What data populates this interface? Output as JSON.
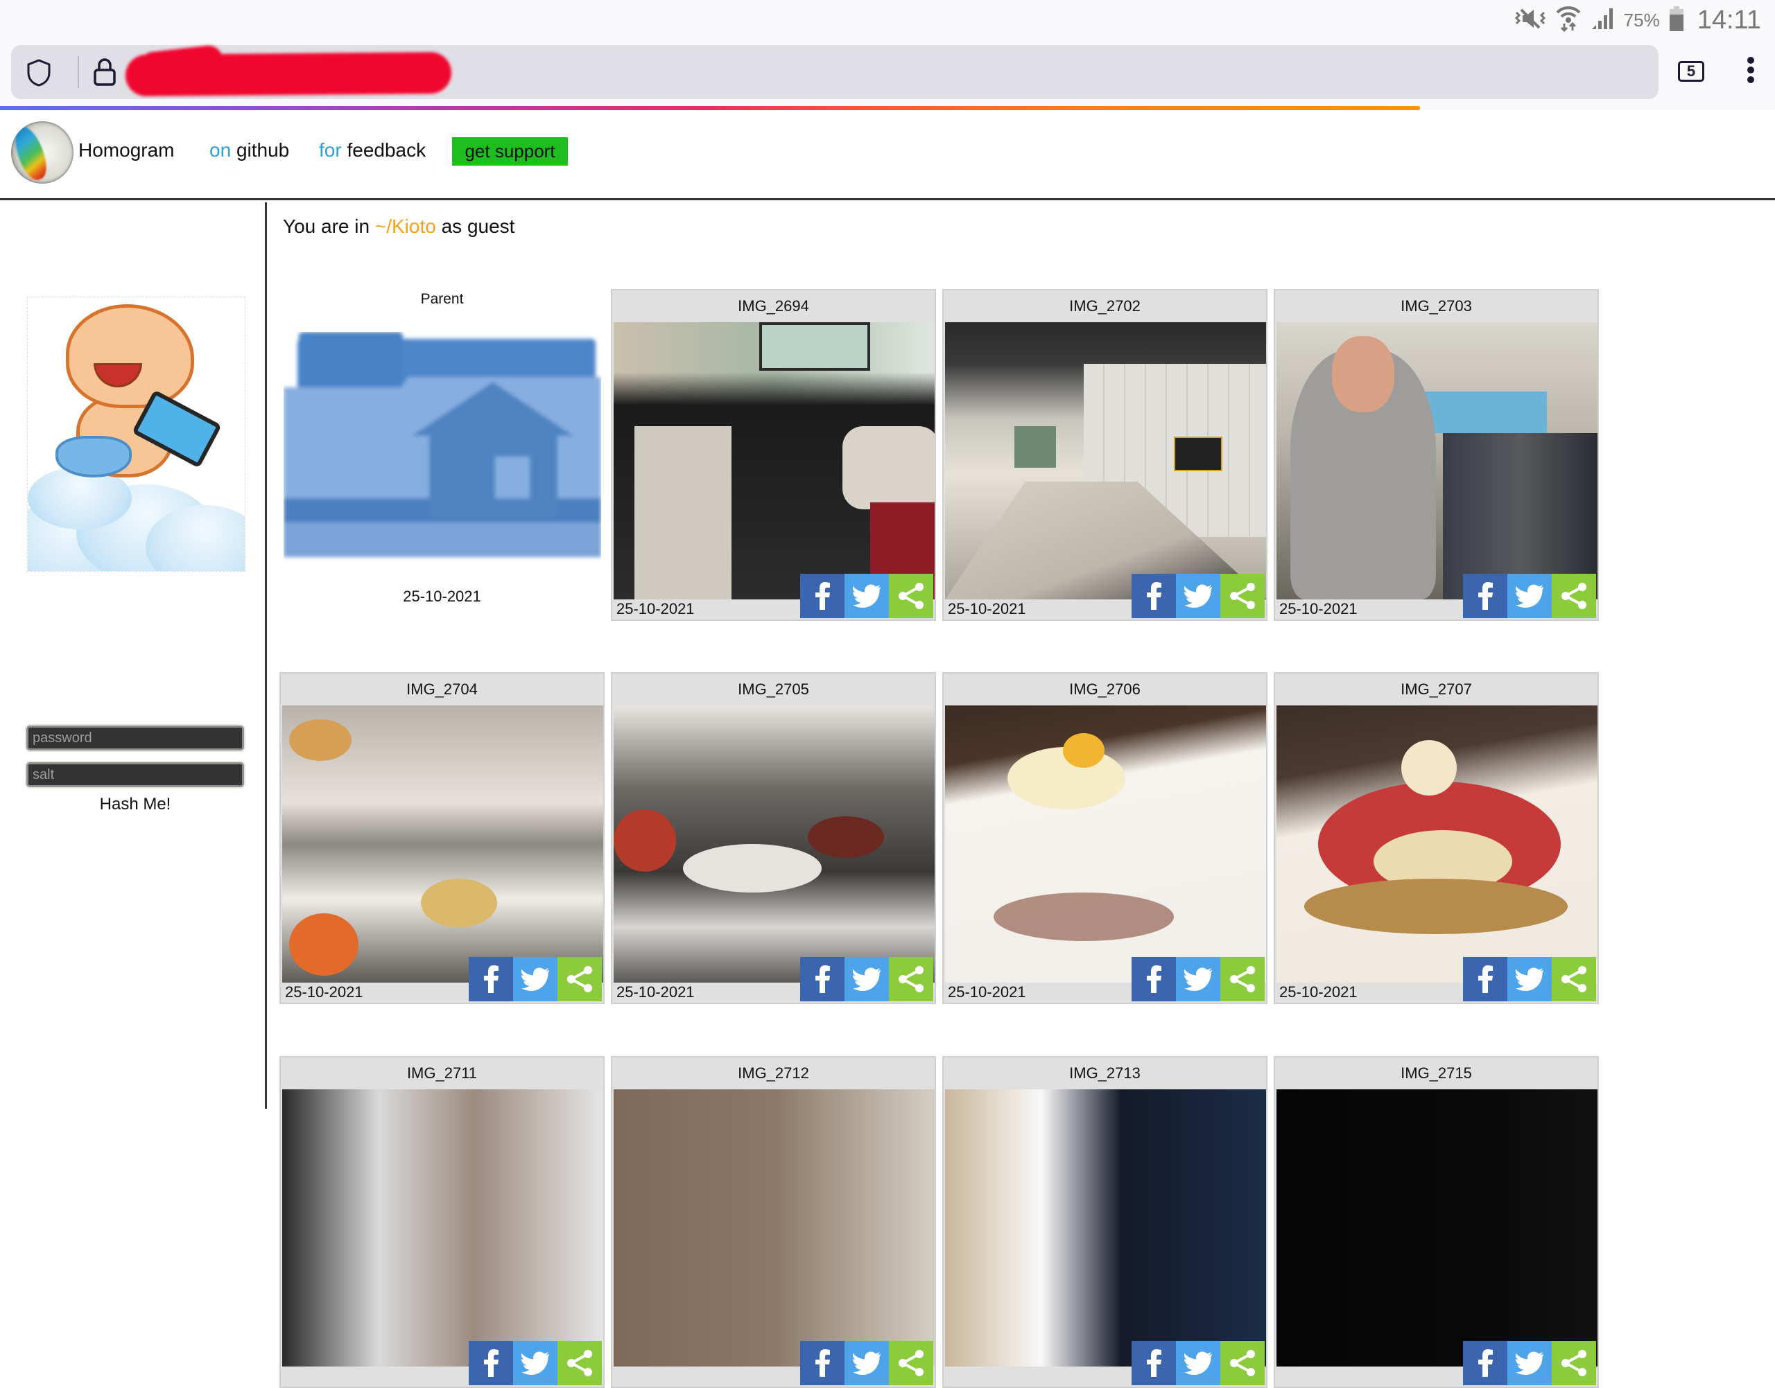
{
  "status_bar": {
    "icons": [
      "vibrate-off-icon",
      "wifi-data-icon",
      "signal-icon"
    ],
    "battery_percent": "75%",
    "battery_icon": "battery-icon",
    "time": "14:11"
  },
  "browser": {
    "url_redacted": true,
    "tab_count": "5",
    "icons": {
      "shield": "shield-icon",
      "lock": "lock-icon",
      "menu": "kebab-menu-icon"
    },
    "load_progress_percent": 80,
    "colors": {
      "urlbar_bg": "#e0dfe5",
      "redaction": "#f0072f"
    }
  },
  "header": {
    "brand": "Homogram",
    "links": [
      {
        "prefix": "on",
        "label": "github"
      },
      {
        "prefix": "for",
        "label": "feedback"
      }
    ],
    "support_button": "get support",
    "colors": {
      "link_prefix": "#2a9fd8",
      "support_bg": "#1dbe1d"
    }
  },
  "sidebar": {
    "password_placeholder": "password",
    "salt_placeholder": "salt",
    "hash_button": "Hash Me!"
  },
  "location": {
    "prefix": "You are in",
    "path": "~/Kioto",
    "suffix": "as guest",
    "path_color": "#f4a21a"
  },
  "gallery": {
    "parent": {
      "title": "Parent",
      "date": "25-10-2021",
      "icon": "home-folder-icon"
    },
    "items": [
      {
        "title": "IMG_2694",
        "date": "25-10-2021"
      },
      {
        "title": "IMG_2702",
        "date": "25-10-2021"
      },
      {
        "title": "IMG_2703",
        "date": "25-10-2021"
      },
      {
        "title": "IMG_2704",
        "date": "25-10-2021"
      },
      {
        "title": "IMG_2705",
        "date": "25-10-2021"
      },
      {
        "title": "IMG_2706",
        "date": "25-10-2021"
      },
      {
        "title": "IMG_2707",
        "date": "25-10-2021"
      },
      {
        "title": "IMG_2711",
        "date": ""
      },
      {
        "title": "IMG_2712",
        "date": ""
      },
      {
        "title": "IMG_2713",
        "date": ""
      },
      {
        "title": "IMG_2715",
        "date": ""
      }
    ],
    "share_buttons": [
      {
        "name": "facebook",
        "color": "#3c65b0"
      },
      {
        "name": "twitter",
        "color": "#4ea4ea"
      },
      {
        "name": "share",
        "color": "#8ccc3c"
      }
    ]
  }
}
